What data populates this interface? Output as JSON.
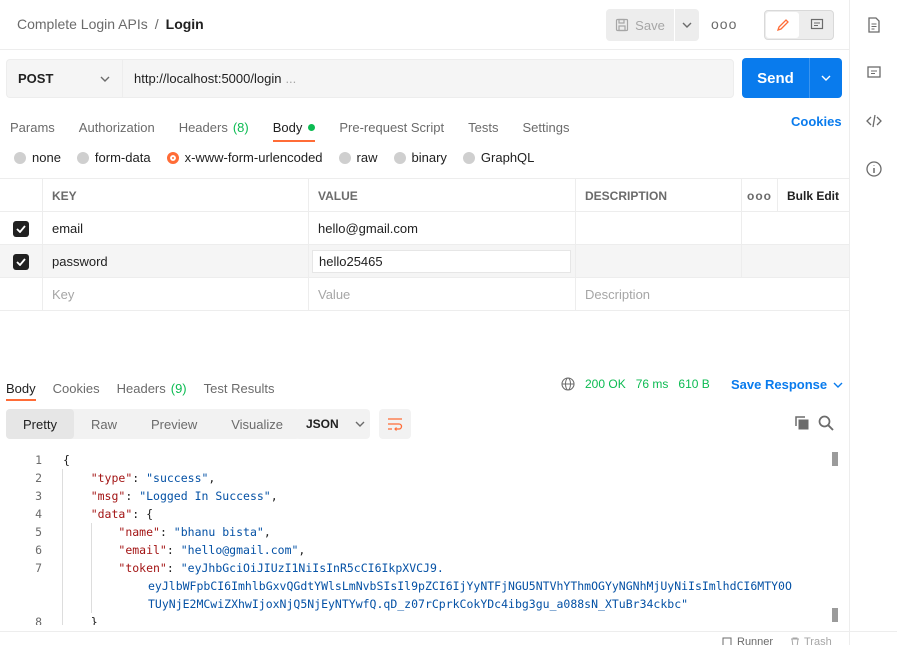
{
  "header": {
    "breadcrumb": {
      "collection": "Complete Login APIs",
      "separator": "/",
      "request": "Login"
    },
    "save_label": "Save",
    "more_label": "ooo"
  },
  "request": {
    "method": "POST",
    "url": "http://localhost:5000/login",
    "url_ellipsis": "...",
    "send_label": "Send"
  },
  "tabs": {
    "params": "Params",
    "authorization": "Authorization",
    "headers": "Headers",
    "headers_count": "(8)",
    "body": "Body",
    "pre_request": "Pre-request Script",
    "tests": "Tests",
    "settings": "Settings",
    "cookies": "Cookies"
  },
  "body_types": {
    "none": "none",
    "form_data": "form-data",
    "urlencoded": "x-www-form-urlencoded",
    "raw": "raw",
    "binary": "binary",
    "graphql": "GraphQL"
  },
  "table": {
    "headers": {
      "key": "KEY",
      "value": "VALUE",
      "description": "DESCRIPTION",
      "more": "ooo",
      "bulk_edit": "Bulk Edit"
    },
    "rows": [
      {
        "key": "email",
        "value": "hello@gmail.com",
        "checked": true
      },
      {
        "key": "password",
        "value": "hello25465",
        "checked": true
      }
    ],
    "placeholders": {
      "key": "Key",
      "value": "Value",
      "description": "Description"
    }
  },
  "response": {
    "tabs": {
      "body": "Body",
      "cookies": "Cookies",
      "headers": "Headers",
      "headers_count": "(9)",
      "test_results": "Test Results"
    },
    "status": "200 OK",
    "time": "76 ms",
    "size": "610 B",
    "save_response": "Save Response",
    "views": {
      "pretty": "Pretty",
      "raw": "Raw",
      "preview": "Preview",
      "visualize": "Visualize"
    },
    "format": "JSON"
  },
  "code": {
    "line_numbers": [
      "1",
      "2",
      "3",
      "4",
      "5",
      "6",
      "7",
      "",
      "",
      "8"
    ],
    "type_key": "\"type\"",
    "type_val": "\"success\"",
    "msg_key": "\"msg\"",
    "msg_val": "\"Logged In Success\"",
    "data_key": "\"data\"",
    "name_key": "\"name\"",
    "name_val": "\"bhanu bista\"",
    "email_key": "\"email\"",
    "email_val": "\"hello@gmail.com\"",
    "token_key": "\"token\"",
    "token_line1": "\"eyJhbGciOiJIUzI1NiIsInR5cCI6IkpXVCJ9.",
    "token_line2": "eyJlbWFpbCI6ImhlbGxvQGdtYWlsLmNvbSIsIl9pZCI6IjYyNTFjNGU5NTVhYThmOGYyNGNhMjUyNiIsImlhdCI6MTY0O",
    "token_line3": "TUyNjE2MCwiZXhwIjoxNjQ5NjEyNTYwfQ.qD_z07rCprkCokYDc4ibg3gu_a088sN_XTuBr34ckbc\""
  },
  "footer": {
    "runner": "Runner",
    "trash": "Trash"
  },
  "colors": {
    "accent": "#ff6c37",
    "primary": "#097bed",
    "success": "#0cbb52"
  }
}
